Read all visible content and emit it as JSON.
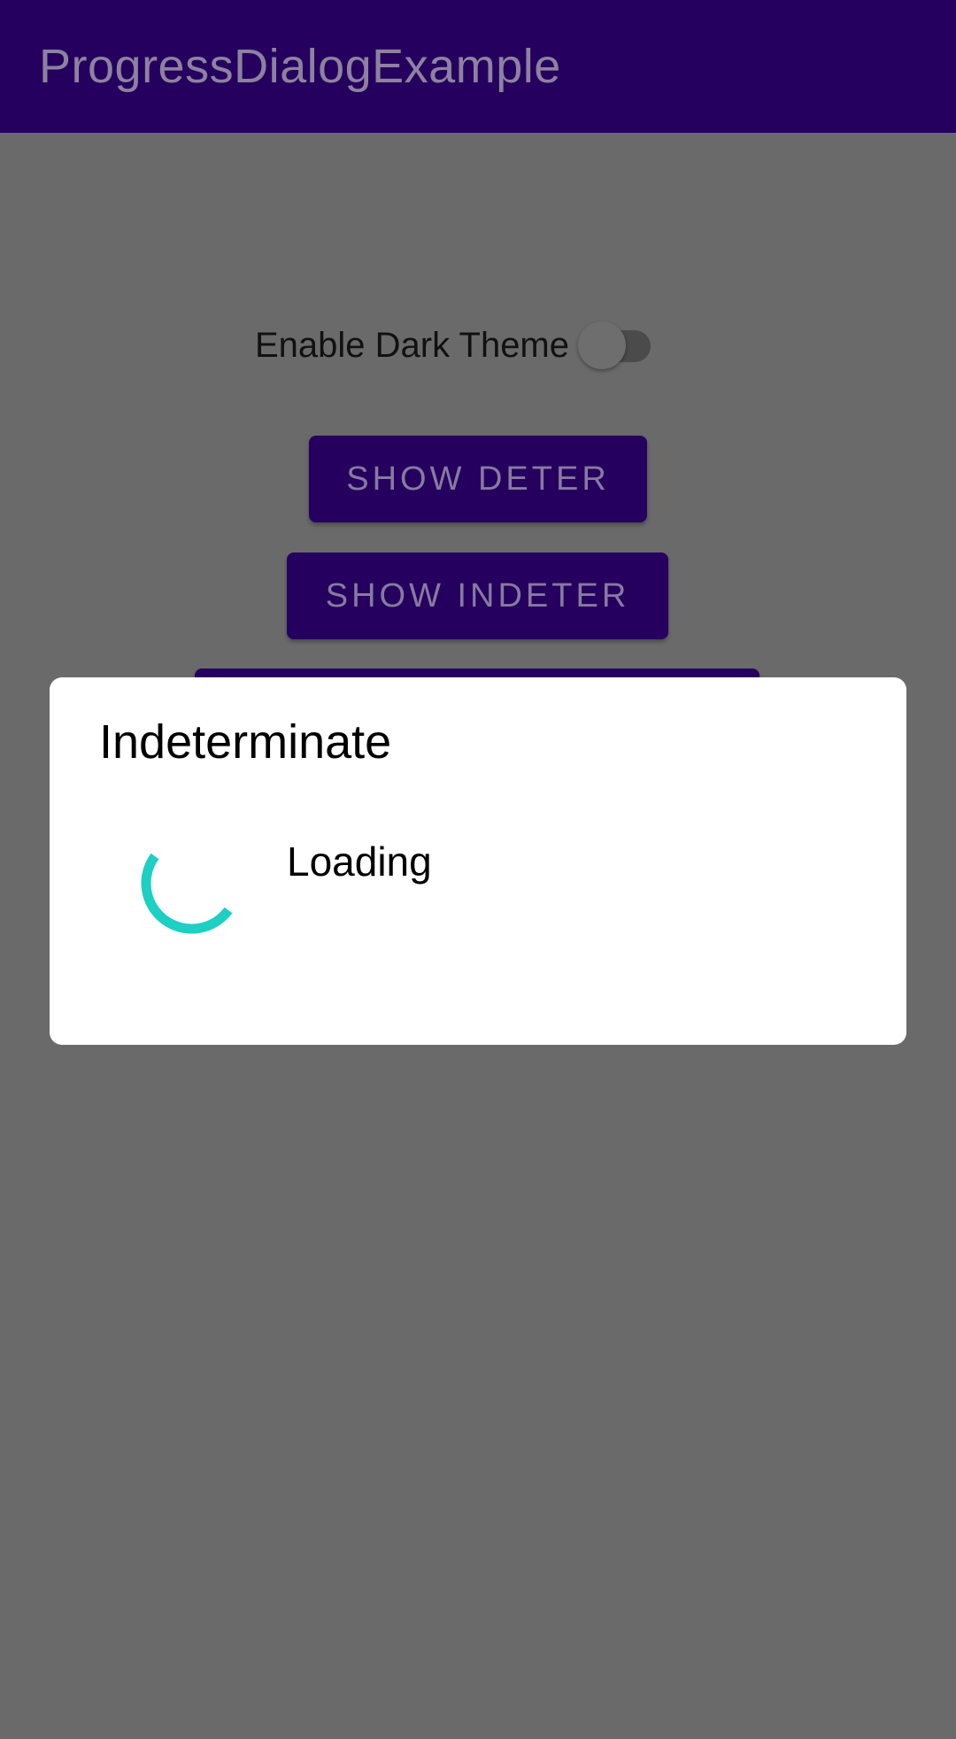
{
  "app_bar": {
    "title": "ProgressDialogExample"
  },
  "main": {
    "dark_theme_toggle": {
      "label": "Enable Dark Theme",
      "checked": false
    },
    "buttons": {
      "show_deter": "SHOW DETER",
      "show_indeter": "SHOW INDETER"
    }
  },
  "dialog": {
    "title": "Indeterminate",
    "message": "Loading",
    "spinner_icon": "circular-progress-icon"
  },
  "colors": {
    "primary": "#25005f",
    "scrim_background": "#6a6a6a",
    "spinner_accent": "#1ecfc3"
  }
}
